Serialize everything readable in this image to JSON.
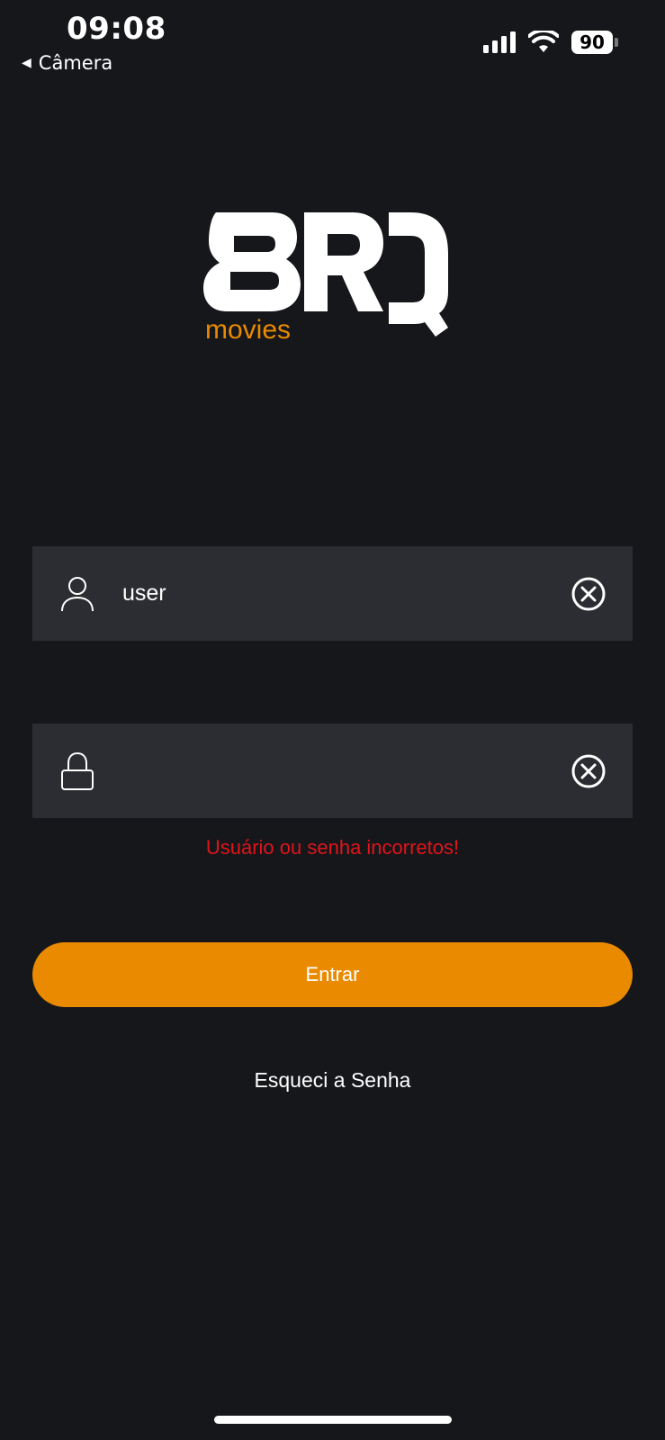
{
  "status_bar": {
    "time": "09:08",
    "back_label": "Câmera",
    "battery_level": "90"
  },
  "logo": {
    "brand": "BRQ",
    "subtitle": "movies",
    "brand_color": "#ffffff",
    "subtitle_color": "#e98a00"
  },
  "form": {
    "username": {
      "value": "user",
      "icon": "user-icon",
      "clear_icon": "clear-icon"
    },
    "password": {
      "value": "",
      "icon": "lock-icon",
      "clear_icon": "clear-icon"
    },
    "error_message": "Usuário ou senha incorretos!",
    "submit_label": "Entrar",
    "forgot_label": "Esqueci a Senha"
  },
  "colors": {
    "background": "#16171b",
    "field_background": "#2c2d32",
    "accent": "#e98a00",
    "error": "#e0141a"
  }
}
